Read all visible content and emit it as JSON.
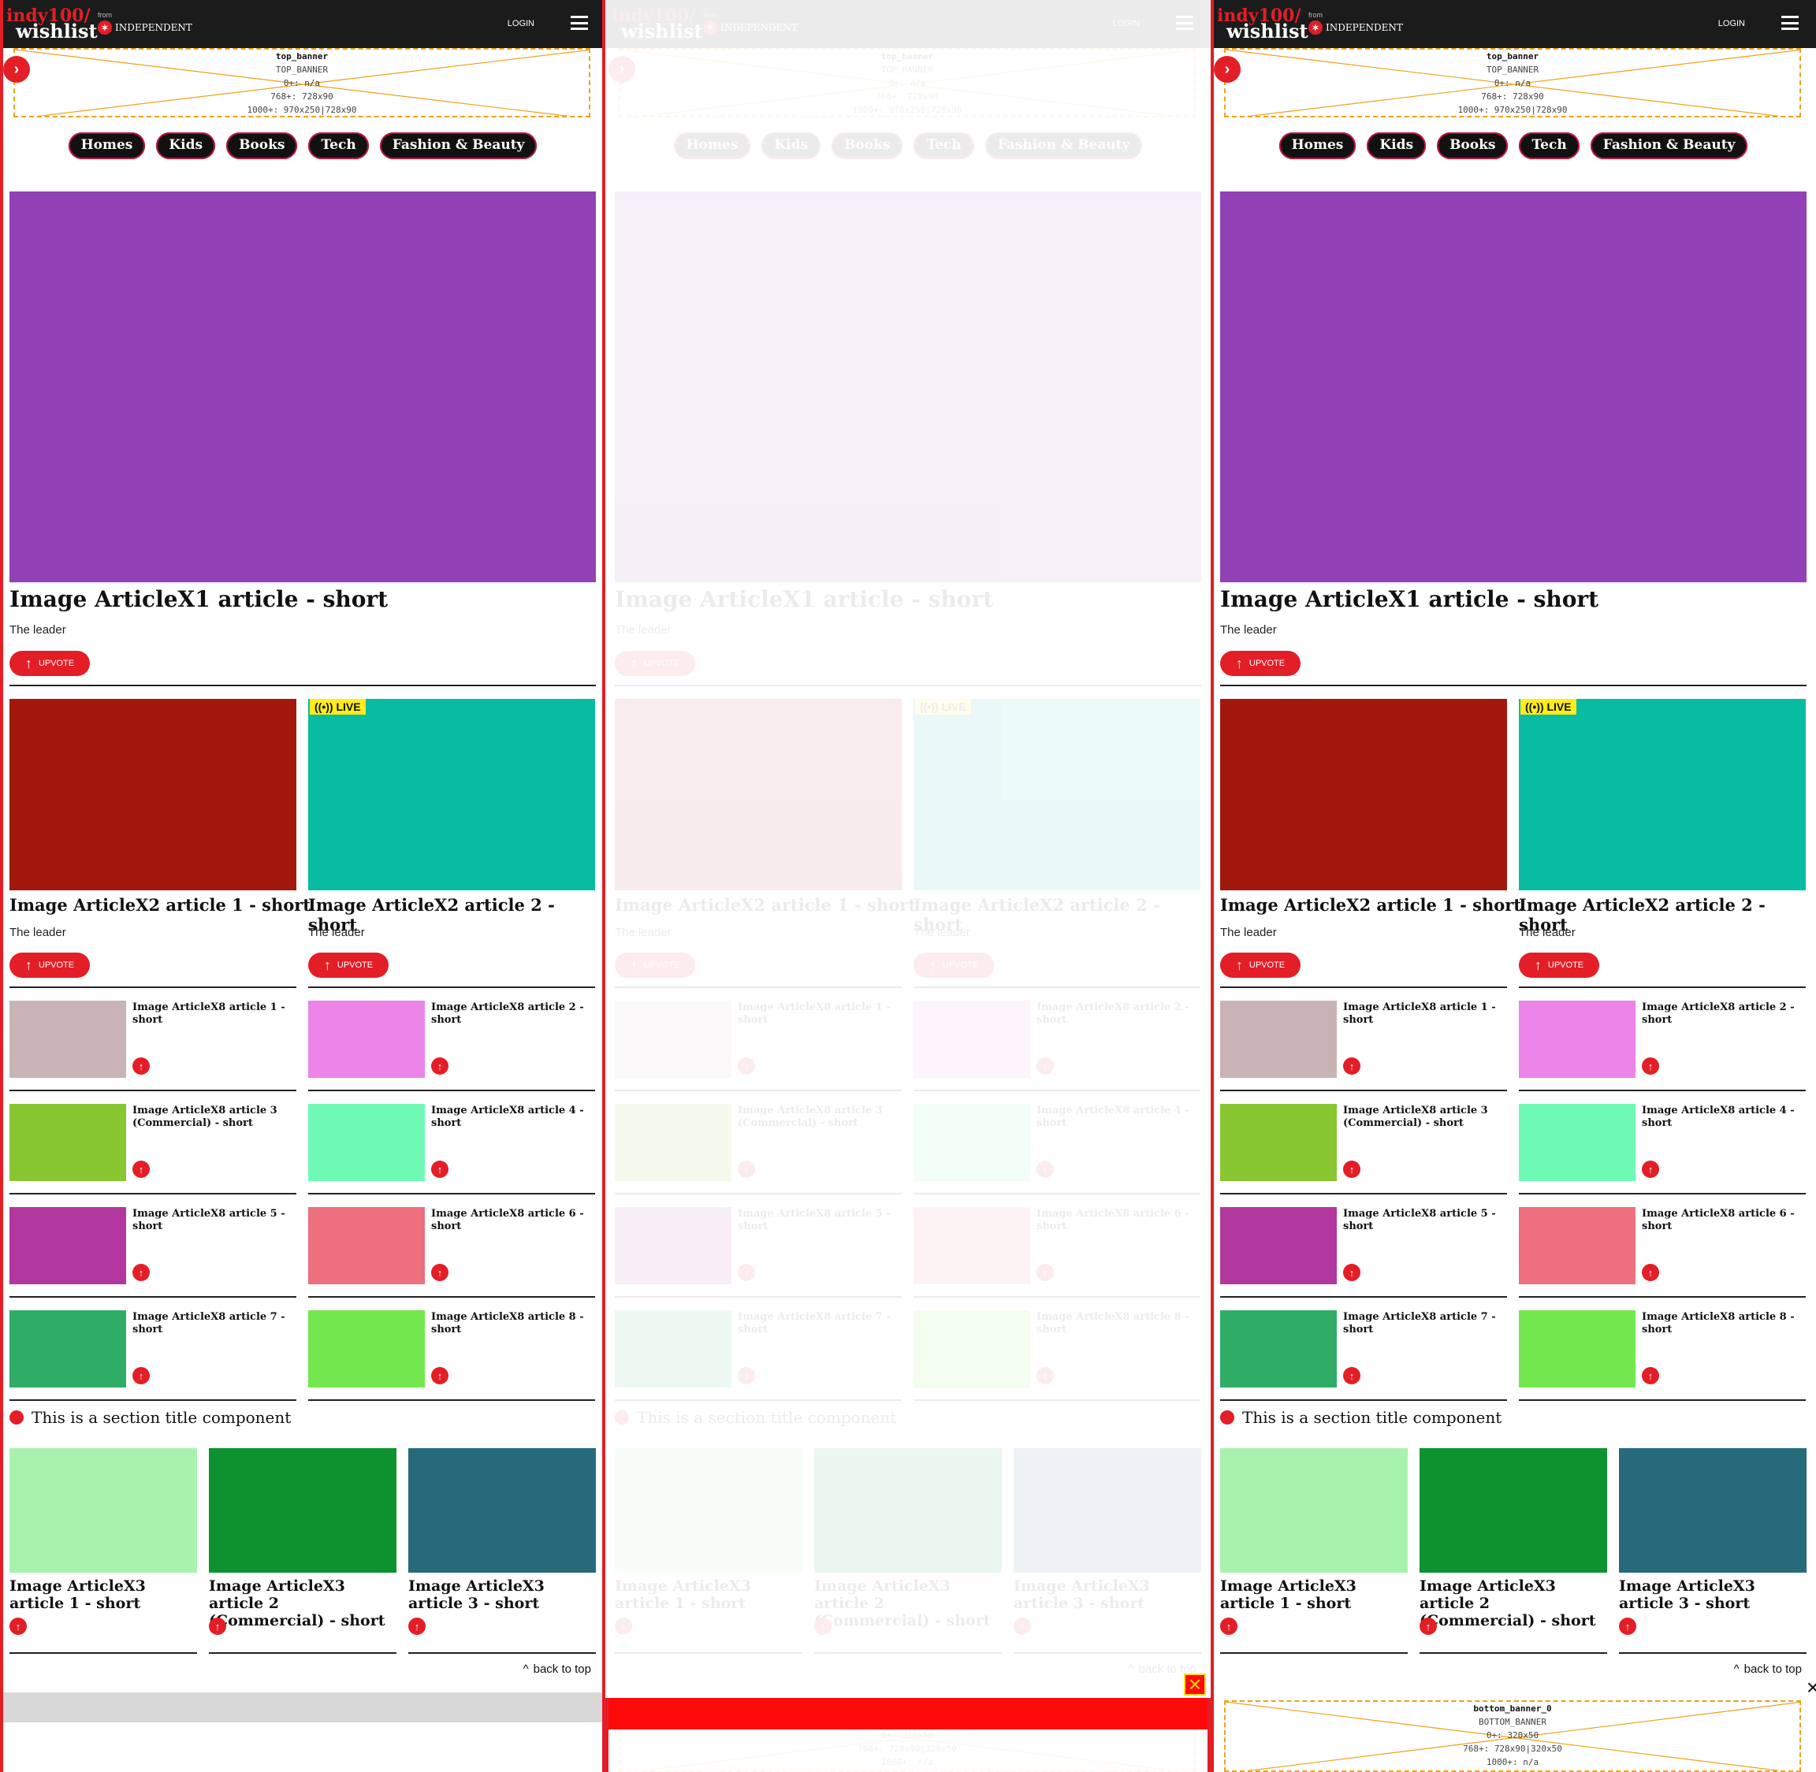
{
  "header": {
    "logo_line1": "indy100/",
    "logo_line2": "wishlist",
    "from": "from",
    "publisher": "INDEPENDENT",
    "login": "LOGIN"
  },
  "top_banner": {
    "name": "top_banner",
    "id": "TOP_BANNER",
    "size_0": "0+: n/a",
    "size_768": "768+: 728x90",
    "size_1000": "1000+: 970x250|728x90"
  },
  "categories": [
    "Homes",
    "Kids",
    "Books",
    "Tech",
    "Fashion & Beauty"
  ],
  "hero": {
    "title": "Image ArticleX1 article - short",
    "leader": "The leader",
    "upvote": "UPVOTE",
    "color": "#9140b5"
  },
  "x2": [
    {
      "title": "Image ArticleX2 article 1 - short",
      "leader": "The leader",
      "upvote": "UPVOTE",
      "color": "#a3180d",
      "live": false
    },
    {
      "title": "Image ArticleX2 article 2 - short",
      "leader": "The leader",
      "upvote": "UPVOTE",
      "color": "#08bca1",
      "live": true
    }
  ],
  "live_label": "LIVE",
  "x8": [
    {
      "title": "Image ArticleX8 article 1 - short",
      "color": "#cab3b4"
    },
    {
      "title": "Image ArticleX8 article 2 - short",
      "color": "#ec84e9"
    },
    {
      "title": "Image ArticleX8 article 3 (Commercial) - short",
      "color": "#88c632"
    },
    {
      "title": "Image ArticleX8 article 4 - short",
      "color": "#6efab5"
    },
    {
      "title": "Image ArticleX8 article 5 - short",
      "color": "#b2389f"
    },
    {
      "title": "Image ArticleX8 article 6 - short",
      "color": "#ee6f7d"
    },
    {
      "title": "Image ArticleX8 article 7 - short",
      "color": "#2fad67"
    },
    {
      "title": "Image ArticleX8 article 8 - short",
      "color": "#73e84e"
    }
  ],
  "section_title": "This is a section title component",
  "x3": [
    {
      "title": "Image ArticleX3 article 1 - short",
      "color": "#a7f3ae"
    },
    {
      "title": "Image ArticleX3 article 2 (Commercial) - short",
      "color": "#0c922e"
    },
    {
      "title": "Image ArticleX3 article 3 - short",
      "color": "#276a7b"
    }
  ],
  "back_to_top": "back to top",
  "bottom_banner": {
    "name": "bottom_banner_0",
    "id": "BOTTOM_BANNER",
    "size_0": "0+: 320x50",
    "size_768": "768+: 728x90|320x50",
    "size_1000": "1000+: n/a"
  },
  "colors": {
    "accent": "#e31e26",
    "header_bg": "#1b1b1b",
    "live_bg": "#ffec1a"
  }
}
